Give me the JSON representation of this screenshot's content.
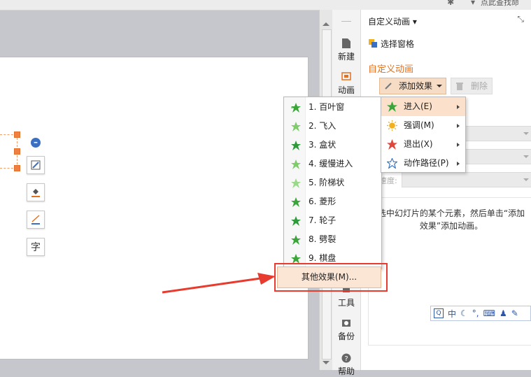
{
  "topbar": {
    "search_text": "点此查找命"
  },
  "rail": {
    "items": [
      {
        "label": "新建"
      },
      {
        "label": "动画"
      },
      {
        "label": "工具"
      },
      {
        "label": "备份"
      },
      {
        "label": "帮助"
      }
    ]
  },
  "pane": {
    "title": "自定义动画",
    "selection_pane": "选择窗格",
    "section_title": "自定义动画",
    "add_effect": "添加效果",
    "delete": "删除",
    "speed_label": "速度:",
    "hint": "选中幻灯片的某个元素，然后单击“添加效果”添加动画。"
  },
  "menu": {
    "items": [
      {
        "label": "进入(E)",
        "icon": "green-star-icon",
        "color": "#3aa63a"
      },
      {
        "label": "强调(M)",
        "icon": "yellow-burst-icon",
        "color": "#f2b01e"
      },
      {
        "label": "退出(X)",
        "icon": "red-star-icon",
        "color": "#e0463a"
      },
      {
        "label": "动作路径(P)",
        "icon": "outline-star-icon",
        "color": "#2f6cc0"
      }
    ]
  },
  "submenu": {
    "items": [
      {
        "label": "1. 百叶窗"
      },
      {
        "label": "2. 飞入"
      },
      {
        "label": "3. 盒状"
      },
      {
        "label": "4. 缓慢进入"
      },
      {
        "label": "5. 阶梯状"
      },
      {
        "label": "6. 菱形"
      },
      {
        "label": "7. 轮子"
      },
      {
        "label": "8. 劈裂"
      },
      {
        "label": "9. 棋盘"
      }
    ],
    "more": "其他效果(M)..."
  },
  "ime": {
    "lang": "中"
  },
  "colors": {
    "accent": "#e3721f",
    "annotation": "#e63b2e",
    "highlight": "#fbe1cb"
  }
}
